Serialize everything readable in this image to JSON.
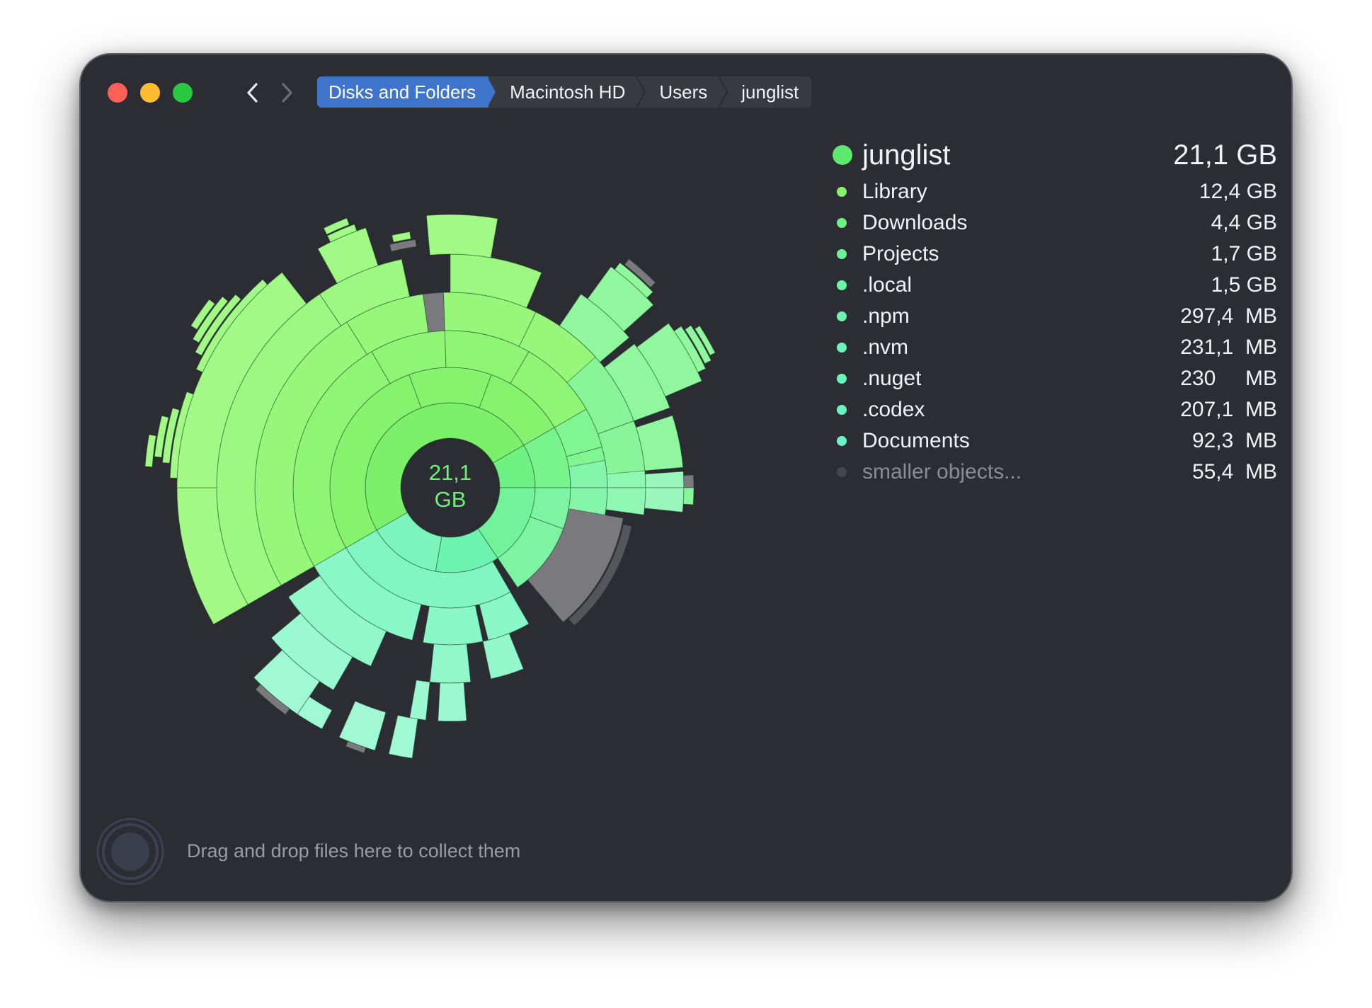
{
  "window": {
    "breadcrumb": [
      "Disks and Folders",
      "Macintosh HD",
      "Users",
      "junglist"
    ]
  },
  "chart_center": {
    "line1": "21,1",
    "line2": "GB"
  },
  "legend": {
    "root": {
      "name": "junglist",
      "size": "21,1 GB",
      "color": "#5ee870"
    },
    "items": [
      {
        "name": "Library",
        "size": "12,4 GB",
        "color": "#86f36e"
      },
      {
        "name": "Downloads",
        "size": "4,4 GB",
        "color": "#6ff283"
      },
      {
        "name": "Projects",
        "size": "1,7 GB",
        "color": "#6cf39a"
      },
      {
        "name": ".local",
        "size": "1,5 GB",
        "color": "#6bf3a8"
      },
      {
        "name": ".npm",
        "size": "297,4  MB",
        "color": "#6bf3b2"
      },
      {
        "name": ".nvm",
        "size": "231,1  MB",
        "color": "#6bf3b8"
      },
      {
        "name": ".nuget",
        "size": "230     MB",
        "color": "#6bf3be"
      },
      {
        "name": ".codex",
        "size": "207,1  MB",
        "color": "#6bf3c2"
      },
      {
        "name": "Documents",
        "size": "92,3  MB",
        "color": "#6bf3c6"
      },
      {
        "name": "smaller objects...",
        "size": "55,4  MB",
        "color": "#45474d",
        "muted": true
      }
    ]
  },
  "drop_zone": {
    "text": "Drag and drop files here to collect them"
  },
  "colors": {
    "window_bg": "#2c2d33",
    "accent": "#3e74c9",
    "small_files": "#7a7a7e"
  }
}
